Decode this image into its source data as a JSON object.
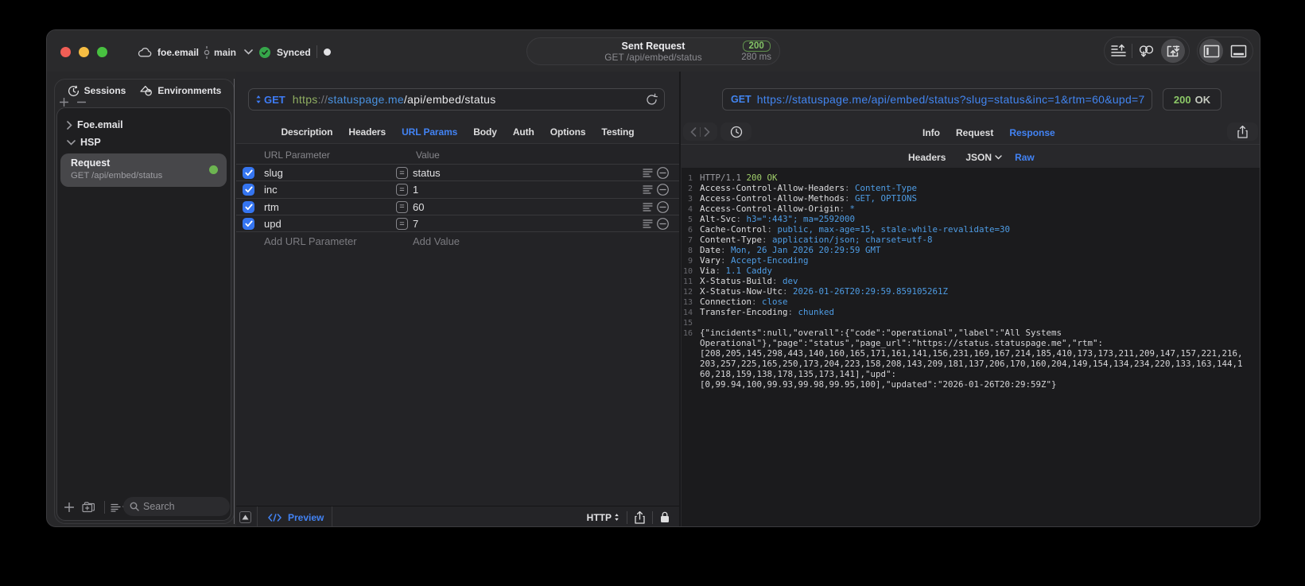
{
  "titlebar": {
    "project": "foe.email",
    "branch": "main",
    "sync_status": "Synced",
    "center": {
      "title": "Sent Request",
      "subtitle": "GET /api/embed/status",
      "status_code": "200",
      "duration": "280 ms"
    }
  },
  "sidebar": {
    "tabs": [
      {
        "label": "Sessions"
      },
      {
        "label": "Environments"
      }
    ],
    "tree": {
      "group1": "Foe.email",
      "group2": "HSP",
      "request": {
        "title": "Request",
        "subtitle": "GET /api/embed/status"
      }
    },
    "search_placeholder": "Search"
  },
  "request_panel": {
    "method": "GET",
    "url": {
      "scheme": "https",
      "separator": "://",
      "host": "statuspage.me",
      "path": "/api/embed/status"
    },
    "tabs": [
      {
        "label": "Description"
      },
      {
        "label": "Headers"
      },
      {
        "label": "URL Params"
      },
      {
        "label": "Body"
      },
      {
        "label": "Auth"
      },
      {
        "label": "Options"
      },
      {
        "label": "Testing"
      }
    ],
    "active_tab": "URL Params",
    "params": {
      "col_name": "URL Parameter",
      "col_value": "Value",
      "operator": "=",
      "rows": [
        {
          "name": "slug",
          "value": "status",
          "enabled": true
        },
        {
          "name": "inc",
          "value": "1",
          "enabled": true
        },
        {
          "name": "rtm",
          "value": "60",
          "enabled": true
        },
        {
          "name": "upd",
          "value": "7",
          "enabled": true
        }
      ],
      "add_name": "Add URL Parameter",
      "add_value": "Add Value"
    },
    "footer": {
      "preview": "Preview",
      "protocol": "HTTP"
    }
  },
  "response_panel": {
    "method": "GET",
    "url": "https://statuspage.me/api/embed/status?slug=status&inc=1&rtm=60&upd=7",
    "status_code": "200",
    "status_text": "OK",
    "tabs": [
      {
        "label": "Info"
      },
      {
        "label": "Request"
      },
      {
        "label": "Response"
      }
    ],
    "active_tab": "Response",
    "subtabs": [
      {
        "label": "Headers"
      },
      {
        "label": "JSON"
      },
      {
        "label": "Raw"
      }
    ],
    "active_subtab": "Raw",
    "raw": {
      "colon": ": ",
      "status_line": {
        "num": "1",
        "protocol": "HTTP/1.1",
        "status": "200 OK"
      },
      "headers": [
        {
          "num": "2",
          "name": "Access-Control-Allow-Headers",
          "value": "Content-Type"
        },
        {
          "num": "3",
          "name": "Access-Control-Allow-Methods",
          "value": "GET, OPTIONS"
        },
        {
          "num": "4",
          "name": "Access-Control-Allow-Origin",
          "value": "*"
        },
        {
          "num": "5",
          "name": "Alt-Svc",
          "value": "h3=\":443\"; ma=2592000"
        },
        {
          "num": "6",
          "name": "Cache-Control",
          "value": "public, max-age=15, stale-while-revalidate=30"
        },
        {
          "num": "7",
          "name": "Content-Type",
          "value": "application/json; charset=utf-8"
        },
        {
          "num": "8",
          "name": "Date",
          "value": "Mon, 26 Jan 2026 20:29:59 GMT"
        },
        {
          "num": "9",
          "name": "Vary",
          "value": "Accept-Encoding"
        },
        {
          "num": "10",
          "name": "Via",
          "value": "1.1 Caddy"
        },
        {
          "num": "11",
          "name": "X-Status-Build",
          "value": "dev"
        },
        {
          "num": "12",
          "name": "X-Status-Now-Utc",
          "value": "2026-01-26T20:29:59.859105261Z"
        },
        {
          "num": "13",
          "name": "Connection",
          "value": "close"
        },
        {
          "num": "14",
          "name": "Transfer-Encoding",
          "value": "chunked"
        }
      ],
      "blank_line_num": "15",
      "body_first_num": "16",
      "body_lines": [
        "{\"incidents\":null,\"overall\":{\"code\":\"operational\",\"label\":\"All Systems",
        "Operational\"},\"page\":\"status\",\"page_url\":\"https://status.statuspage.me\",\"rtm\":",
        "[208,205,145,298,443,140,160,165,171,161,141,156,231,169,167,214,185,410,173,173,211,209,147,157,221,216,",
        "203,257,225,165,250,173,204,223,158,208,143,209,181,137,206,170,160,204,149,154,134,234,220,133,163,144,1",
        "60,218,159,138,178,135,173,141],\"upd\":",
        "[0,99.94,100,99.93,99.98,99.95,100],\"updated\":\"2026-01-26T20:29:59Z\"}"
      ]
    }
  }
}
